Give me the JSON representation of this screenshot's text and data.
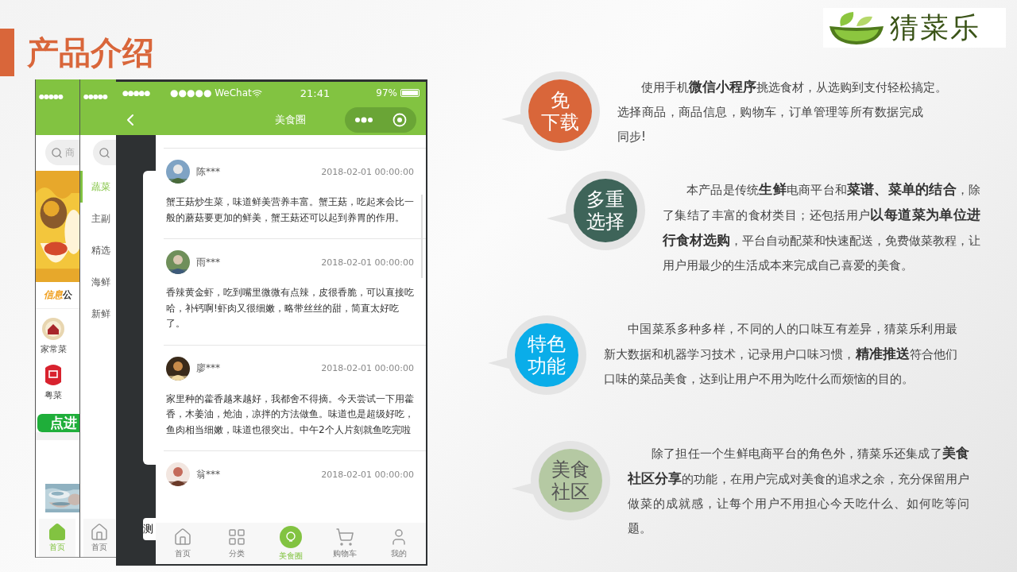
{
  "title": "产品介绍",
  "logo": {
    "text": "猜菜乐"
  },
  "phones": {
    "back_screen": {
      "status": "●●●●●",
      "search_placeholder": "商",
      "notice_tag": "信息",
      "notice_text": "公",
      "categories": [
        {
          "label": "家常菜",
          "kind": "home"
        },
        {
          "label": "粤菜",
          "kind": "seal"
        }
      ],
      "button": "点进",
      "tab": {
        "label": "首页",
        "selected": true
      }
    },
    "middle_screen": {
      "status": "●●●●●",
      "menu": [
        {
          "label": "蔬菜",
          "selected": true
        },
        {
          "label": "主副",
          "selected": false
        },
        {
          "label": "精选",
          "selected": false
        },
        {
          "label": "海鲜",
          "selected": false
        },
        {
          "label": "新鲜",
          "selected": false
        }
      ],
      "tab": {
        "label": "首页",
        "selected": false
      }
    },
    "third_screen": {
      "status": "●●●●●",
      "label": "测"
    },
    "main_screen": {
      "carrier": "●●●●● WeChat",
      "time": "21:41",
      "battery": "97%",
      "title": "美食圈",
      "posts": [
        {
          "name": "陈***",
          "date": "2018-02-01 00:00:00",
          "text": "蟹王菇炒生菜，味道鲜美营养丰富。蟹王菇，吃起来会比一般的蘑菇要更加的鲜美，蟹王菇还可以起到养胃的作用。"
        },
        {
          "name": "雨***",
          "date": "2018-02-01 00:00:00",
          "text": "香辣黄金虾，吃到嘴里微微有点辣，皮很香脆，可以直接吃哈，补钙啊!虾肉又很细嫩，略带丝丝的甜，简直太好吃了。"
        },
        {
          "name": "廖***",
          "date": "2018-02-01 00:00:00",
          "text": "家里种的藿香越来越好，我都舍不得摘。今天尝试一下用藿香，木姜油，炝油，凉拌的方法做鱼。味道也是超级好吃，鱼肉相当细嫩，味道也很突出。中午2个人片刻就鱼吃完啦"
        },
        {
          "name": "翁***",
          "date": "2018-02-01 00:00:00"
        }
      ],
      "tabs": [
        {
          "label": "首页",
          "kind": "home",
          "selected": false
        },
        {
          "label": "分类",
          "kind": "grid",
          "selected": false
        },
        {
          "label": "美食圈",
          "kind": "food",
          "selected": true
        },
        {
          "label": "购物车",
          "kind": "cart",
          "selected": false
        },
        {
          "label": "我的",
          "kind": "user",
          "selected": false
        }
      ]
    }
  },
  "features": [
    {
      "label": [
        "免",
        "下载"
      ],
      "color": "#d9663a",
      "paragraphs": [
        "使用手机**微信小程序**挑选食材，从选购到支付轻松搞定。",
        "选择商品，商品信息，购物车，订单管理等所有数据完成同步!"
      ]
    },
    {
      "label": [
        "多重",
        "选择"
      ],
      "color": "#3e6459",
      "paragraphs": [
        "本产品是传统**生鲜**电商平台和**菜谱、菜单的结合**，除了集结了丰富的食材类目；还包括用户**以每道菜为单位进行食材选购**，平台自动配菜和快速配送，免费做菜教程，让用户用最少的生活成本来完成自己喜爱的美食。"
      ]
    },
    {
      "label": [
        "特色",
        "功能"
      ],
      "color": "#0aade9",
      "paragraphs": [
        "中国菜系多种多样，不同的人的口味互有差异，猜菜乐利用最新大数据和机器学习技术，记录用户口味习惯，**精准推送**符合他们口味的菜品美食，达到让用户不用为吃什么而烦恼的目的。"
      ]
    },
    {
      "label": [
        "美食",
        "社区"
      ],
      "color": "#b5c9a3",
      "paragraphs": [
        "除了担任一个生鲜电商平台的角色外，猜菜乐还集成了**美食社区分享**的功能，在用户完成对美食的追求之余，充分保留用户做菜的成就感，让每个用户不用担心今天吃什么、如何吃等问题。"
      ]
    }
  ]
}
